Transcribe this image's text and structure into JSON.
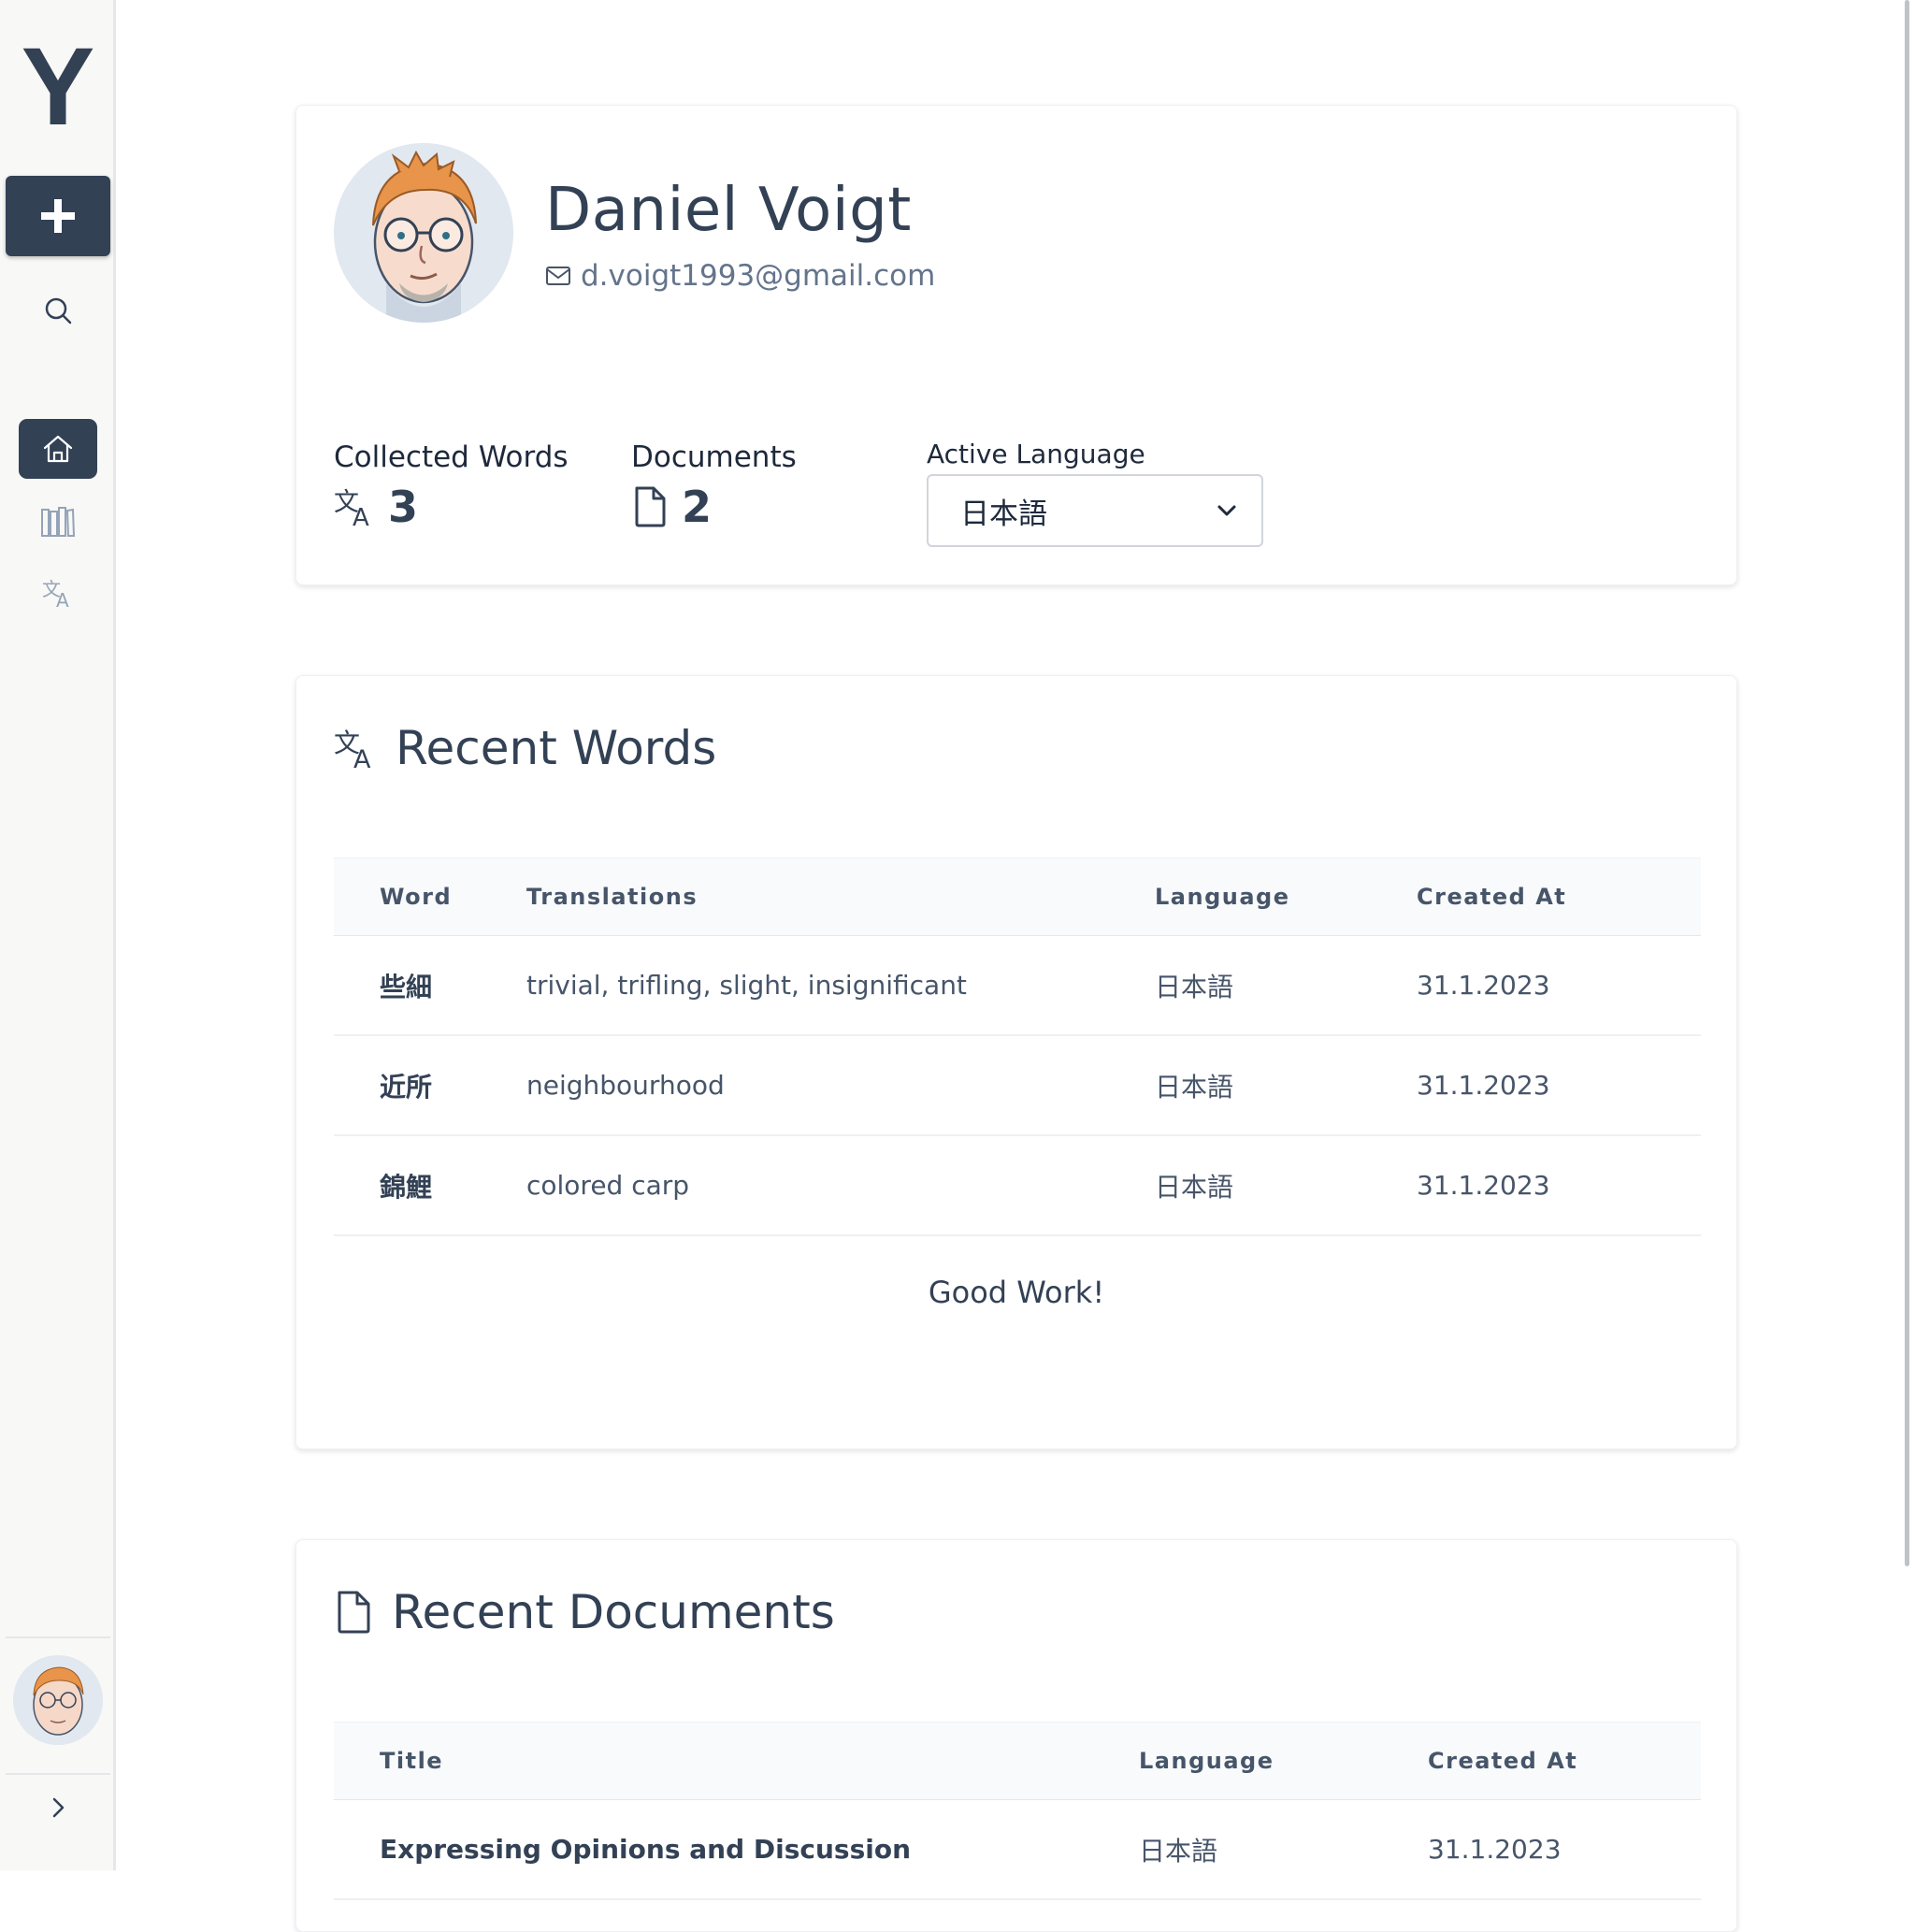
{
  "sidebar": {
    "logo": "Y",
    "nav": [
      {
        "name": "home-icon",
        "active": true
      },
      {
        "name": "library-icon",
        "active": false
      },
      {
        "name": "translate-icon",
        "active": false
      }
    ]
  },
  "profile": {
    "name": "Daniel Voigt",
    "email": "d.voigt1993@gmail.com",
    "collected_words_label": "Collected Words",
    "collected_words_value": "3",
    "documents_label": "Documents",
    "documents_value": "2",
    "active_language_label": "Active Language",
    "active_language_value": "日本語"
  },
  "recent_words": {
    "title": "Recent Words",
    "columns": [
      "Word",
      "Translations",
      "Language",
      "Created At"
    ],
    "rows": [
      {
        "word": "些細",
        "translations": "trivial, trifling, slight, insignificant",
        "language": "日本語",
        "created_at": "31.1.2023"
      },
      {
        "word": "近所",
        "translations": "neighbourhood",
        "language": "日本語",
        "created_at": "31.1.2023"
      },
      {
        "word": "錦鯉",
        "translations": "colored carp",
        "language": "日本語",
        "created_at": "31.1.2023"
      }
    ],
    "footer": "Good Work!"
  },
  "recent_documents": {
    "title": "Recent Documents",
    "columns": [
      "Title",
      "Language",
      "Created At"
    ],
    "rows": [
      {
        "title": "Expressing Opinions and Discussion",
        "language": "日本語",
        "created_at": "31.1.2023"
      }
    ]
  },
  "colors": {
    "accent": "#334155",
    "sidebar_bg": "#f8f8f6",
    "table_header_bg": "#f8fafc"
  }
}
